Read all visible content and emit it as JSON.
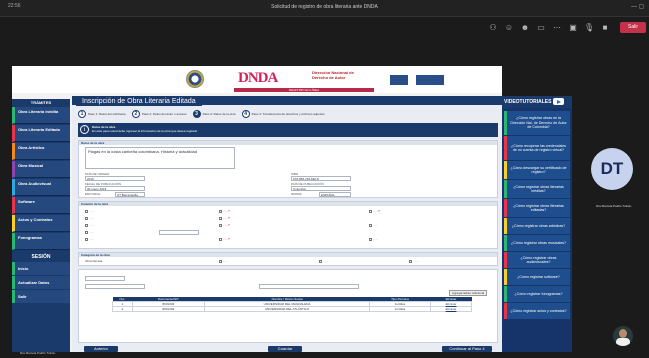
{
  "window": {
    "title": "Solicitud de registro de obra literaria ante DNDA",
    "timer": "22:56",
    "leave_label": "Salir"
  },
  "banner": {
    "logo": "DNDA",
    "logo_text": "Dirección Nacional de Derecho de Autor",
    "redbar_text": "REGISTRO EN LÍNEA"
  },
  "left_nav": {
    "header": "TRÁMITES",
    "items": [
      {
        "label": "Obra Literaria Inédita"
      },
      {
        "label": "Obra Literaria Editada"
      },
      {
        "label": "Obra Artística"
      },
      {
        "label": "Obra Musical"
      },
      {
        "label": "Obra Audiovisual"
      },
      {
        "label": "Software"
      },
      {
        "label": "Actos y Contratos"
      },
      {
        "label": "Fonogramas"
      }
    ],
    "session_header": "SESIÓN",
    "session_items": [
      {
        "label": "Inicio"
      },
      {
        "label": "Actualizar Datos"
      },
      {
        "label": "Salir"
      }
    ]
  },
  "main": {
    "title": "Inscripción de Obra Literaria Editada",
    "steps": [
      {
        "num": "1",
        "label": "Paso 1: Datos del solicitante"
      },
      {
        "num": "2",
        "label": "Paso 2: Datos del autor o autores"
      },
      {
        "num": "3",
        "label": "Paso 3: Datos de la obra"
      },
      {
        "num": "4",
        "label": "Paso 4: Transferencia de derechos y archivos adjuntos"
      }
    ],
    "info_title": "Datos de la obra",
    "info_text": "En este paso usted debe ingresar la información de la obra que desea registrar",
    "work_title_value": "Plagas en la costa caribeña colombiana. Historia y actualidad",
    "section_labels": {
      "work": "Datos de la obra",
      "character": "Carácter de la obra",
      "category": "Categoría de la obra"
    },
    "fields": {
      "pais_label": "PAÍS DE ORIGEN",
      "pais_value": "2019",
      "fecha_label": "FECHA DE PUBLICACIÓN",
      "fecha_value": "30 enero 2019",
      "isbn_label": "ISBN",
      "isbn_value": "978-958-746-640-8",
      "editorial_label": "EDITORIAL",
      "editorial_value": "UT Barranquilla",
      "idioma_label": "IDIOMA",
      "idioma_value": "ESPAÑOL",
      "pais2_label": "PAÍS DE PUBLICACIÓN",
      "pais2_value": "Colombia",
      "categoria_value": "Obra literaria"
    },
    "table": {
      "headers": [
        "Nro.",
        "Documento/NIT",
        "Nombre / Razón Social",
        "Tipo Persona",
        "Eliminar"
      ],
      "rows": [
        [
          "1",
          "8001403",
          "UNIVERSIDAD DEL MAGDALENA",
          "Jurídica",
          "Eliminar"
        ],
        [
          "2",
          "8001403",
          "UNIVERSIDAD DEL ATLÁNTICO",
          "Jurídica",
          "Eliminar"
        ]
      ]
    },
    "add_button": "Agregar Editor Adicional",
    "buttons": {
      "back": "Anterior",
      "save": "Guardar",
      "next": "Continuar al Paso 4"
    }
  },
  "video_panel": {
    "header": "VIDEOTUTORIALES",
    "items": [
      "¿Cómo registrar obras en la Dirección Nal. de Derecho de Autor de Colombia?",
      "¿Cómo recuperar las credenciales de mi cuenta de registro virtual?",
      "¿Cómo descargar su certificado de registro?",
      "¿Cómo registrar obras literarias inéditas?",
      "¿Cómo registrar obras literarias editadas?",
      "¿Cómo registrar obras artísticas?",
      "¿Cómo registrar obras musicales?",
      "¿Cómo registrar obras audiovisuales?",
      "¿Cómo registrar software?",
      "¿Cómo registrar fonogramas?",
      "¿Cómo registrar actos y contratos?"
    ]
  },
  "participants": {
    "initials": "DT",
    "name": "Dra Marcela Patiño Tulcan",
    "bottom_name": "Dra Marcela Patiño Tulcan"
  }
}
